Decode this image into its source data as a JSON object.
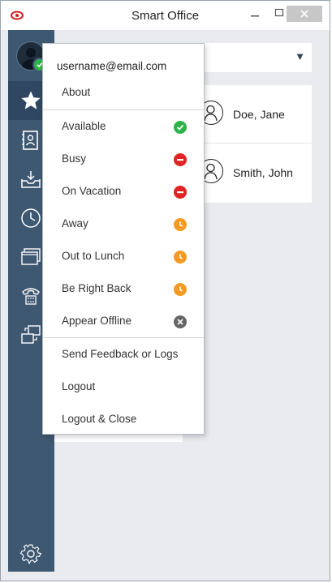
{
  "window": {
    "title": "Smart Office"
  },
  "sidebar": {
    "items": [
      {
        "icon": "star-icon"
      },
      {
        "icon": "contact-book-icon"
      },
      {
        "icon": "inbox-download-icon"
      },
      {
        "icon": "clock-icon"
      },
      {
        "icon": "windows-stack-icon"
      },
      {
        "icon": "phone-icon"
      },
      {
        "icon": "transfer-icon"
      },
      {
        "icon": "gear-icon"
      }
    ]
  },
  "contacts": [
    {
      "name": "Doe, Jane"
    },
    {
      "name": "Smith, John"
    }
  ],
  "menu": {
    "username": "username@email.com",
    "about": "About",
    "statuses": [
      {
        "label": "Available",
        "status": "available",
        "color": "#2db34a"
      },
      {
        "label": "Busy",
        "status": "busy",
        "color": "#e02424"
      },
      {
        "label": "On Vacation",
        "status": "busy",
        "color": "#e02424"
      },
      {
        "label": "Away",
        "status": "away",
        "color": "#f59a23"
      },
      {
        "label": "Out to Lunch",
        "status": "away",
        "color": "#f59a23"
      },
      {
        "label": "Be Right Back",
        "status": "away",
        "color": "#f59a23"
      },
      {
        "label": "Appear Offline",
        "status": "offline",
        "color": "#666666"
      }
    ],
    "feedback": "Send Feedback or Logs",
    "logout": "Logout",
    "logout_close": "Logout & Close"
  }
}
